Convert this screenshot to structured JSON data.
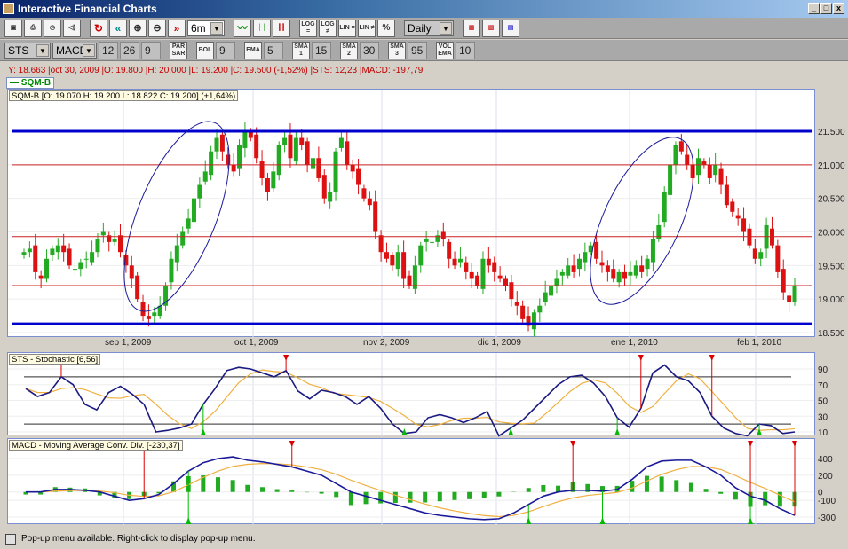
{
  "window": {
    "title": "Interactive Financial Charts",
    "min": "_",
    "max": "□",
    "close": "x"
  },
  "toolbar1": {
    "period": "6m",
    "interval": "Daily",
    "log_labels": [
      "LOG =",
      "LOG ≠",
      "LIN =",
      "LIN ≠",
      "%"
    ]
  },
  "toolbar2": {
    "indicator1": "STS",
    "indicator2": "MACD",
    "macd_params": [
      "12",
      "26",
      "9"
    ],
    "par_sar": "PAR SAR",
    "bol": "BOL",
    "bol_val": "9",
    "ema": "EMA",
    "ema_val": "5",
    "sma1": "SMA 1",
    "sma1_val": "15",
    "sma2": "SMA 2",
    "sma2_val": "30",
    "sma3": "SMA 3",
    "sma3_val": "95",
    "vol_ema": "VOL EMA",
    "vol_ema_val": "10"
  },
  "info_line": "Y: 18.663 |oct 30, 2009 |O: 19.800 |H: 20.000 |L: 19.200 |C: 19.500 (-1,52%) |STS: 12,23 |MACD: -197,79",
  "legend": "SQM-B",
  "price_panel": {
    "title": "SQM-B [O: 19.070  H: 19.200  L: 18.822  C: 19.200] (+1,64%)",
    "y_ticks": [
      "21.500",
      "21.000",
      "20.500",
      "20.000",
      "19.500",
      "19.000",
      "18.500"
    ],
    "y_tick_values": [
      21.5,
      21.0,
      20.5,
      20.0,
      19.5,
      19.0,
      18.5
    ],
    "ymin": 18.45,
    "ymax": 21.95,
    "x_labels": [
      "sep 1, 2009",
      "oct 1, 2009",
      "nov 2, 2009",
      "dic 1, 2009",
      "ene 1, 2010",
      "feb 1, 2010"
    ],
    "blue_levels": [
      21.5,
      18.63
    ],
    "red_levels": [
      21.0,
      19.93,
      19.2
    ],
    "closes": [
      19.7,
      19.75,
      19.4,
      19.3,
      19.6,
      19.75,
      19.8,
      19.7,
      19.5,
      19.45,
      19.55,
      19.6,
      19.7,
      19.9,
      20.0,
      19.85,
      19.9,
      19.7,
      19.5,
      19.3,
      19.0,
      18.75,
      18.7,
      18.8,
      18.9,
      19.2,
      19.6,
      19.8,
      20.0,
      20.2,
      20.5,
      20.7,
      20.9,
      21.2,
      21.4,
      21.2,
      21.0,
      20.9,
      21.3,
      21.5,
      21.4,
      21.1,
      20.8,
      20.6,
      20.9,
      21.3,
      21.4,
      21.1,
      21.4,
      21.3,
      21.0,
      21.1,
      20.8,
      20.5,
      20.6,
      21.2,
      21.4,
      21.0,
      20.9,
      20.7,
      20.5,
      20.4,
      20.0,
      19.7,
      19.6,
      19.5,
      19.7,
      19.3,
      19.2,
      19.5,
      19.8,
      19.9,
      19.85,
      19.95,
      19.9,
      19.6,
      19.5,
      19.6,
      19.4,
      19.3,
      19.2,
      19.6,
      19.5,
      19.4,
      19.3,
      19.2,
      19.0,
      18.9,
      18.7,
      18.6,
      18.8,
      18.9,
      19.1,
      19.2,
      19.3,
      19.4,
      19.5,
      19.4,
      19.6,
      19.7,
      19.8,
      19.6,
      19.5,
      19.4,
      19.3,
      19.4,
      19.3,
      19.4,
      19.5,
      19.4,
      19.6,
      19.9,
      20.1,
      20.6,
      21.0,
      21.3,
      21.2,
      21.0,
      20.8,
      21.1,
      21.0,
      20.8,
      21.0,
      20.7,
      20.4,
      20.3,
      20.2,
      20.0,
      19.8,
      19.6,
      19.7,
      20.1,
      19.8,
      19.4,
      19.1,
      18.95,
      19.2
    ]
  },
  "sts_panel": {
    "title": "STS - Stochastic [6,56]",
    "y_ticks": [
      "90",
      "70",
      "50",
      "30",
      "10"
    ],
    "y_tick_values": [
      90,
      70,
      50,
      30,
      10
    ],
    "levels": [
      80,
      20
    ],
    "k": [
      65,
      55,
      60,
      80,
      70,
      45,
      38,
      60,
      68,
      58,
      45,
      10,
      12,
      15,
      20,
      45,
      65,
      88,
      92,
      90,
      85,
      80,
      88,
      62,
      52,
      63,
      60,
      55,
      45,
      55,
      40,
      20,
      8,
      10,
      28,
      32,
      28,
      22,
      28,
      36,
      5,
      15,
      25,
      40,
      55,
      70,
      80,
      82,
      72,
      55,
      28,
      16,
      40,
      85,
      95,
      80,
      75,
      60,
      30,
      15,
      8,
      5,
      20,
      18,
      8,
      10
    ],
    "sell_signals": [
      3,
      22,
      52,
      58
    ],
    "buy_signals": [
      15,
      32,
      41,
      50,
      62
    ]
  },
  "macd_panel": {
    "title": "MACD - Moving Average Conv. Div. [-230,37]",
    "y_ticks": [
      "400",
      "200",
      "0",
      "-100",
      "-300"
    ],
    "y_tick_values": [
      400,
      200,
      0,
      -100,
      -300
    ],
    "macd": [
      0,
      0,
      30,
      30,
      20,
      0,
      -50,
      -100,
      -80,
      -30,
      100,
      250,
      350,
      400,
      420,
      380,
      360,
      330,
      300,
      250,
      200,
      100,
      0,
      -50,
      -100,
      -150,
      -200,
      -250,
      -280,
      -300,
      -320,
      -330,
      -320,
      -250,
      -150,
      -50,
      0,
      20,
      20,
      10,
      30,
      150,
      300,
      370,
      380,
      380,
      300,
      200,
      50,
      -50,
      -100,
      -200,
      -280
    ],
    "sell_signals": [
      8,
      18,
      37,
      49,
      52
    ],
    "buy_signals": [
      11,
      34,
      39,
      49
    ]
  },
  "status_text": "Pop-up menu available. Right-click to display pop-up menu.",
  "colors": {
    "up": "#22aa22",
    "down": "#dd1111",
    "blue": "#0000cc",
    "signal": "#f0b040"
  }
}
